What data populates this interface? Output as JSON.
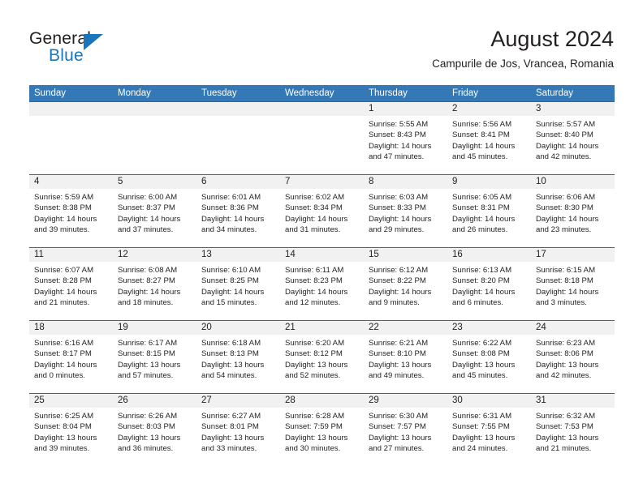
{
  "brand": {
    "name_part1": "General",
    "name_part2": "Blue",
    "triangle_color": "#1b75bb"
  },
  "header": {
    "title": "August 2024",
    "subtitle": "Campurile de Jos, Vrancea, Romania",
    "accent_color": "#3479b5",
    "numbers_strip_color": "#f1f1f1"
  },
  "day_names": [
    "Sunday",
    "Monday",
    "Tuesday",
    "Wednesday",
    "Thursday",
    "Friday",
    "Saturday"
  ],
  "labels": {
    "sunrise_prefix": "Sunrise:",
    "sunset_prefix": "Sunset:",
    "daylight_prefix": "Daylight:"
  },
  "weeks": [
    [
      {
        "day": "",
        "sunrise": "",
        "sunset": "",
        "daylight_line1": "",
        "daylight_line2": ""
      },
      {
        "day": "",
        "sunrise": "",
        "sunset": "",
        "daylight_line1": "",
        "daylight_line2": ""
      },
      {
        "day": "",
        "sunrise": "",
        "sunset": "",
        "daylight_line1": "",
        "daylight_line2": ""
      },
      {
        "day": "",
        "sunrise": "",
        "sunset": "",
        "daylight_line1": "",
        "daylight_line2": ""
      },
      {
        "day": "1",
        "sunrise": "Sunrise: 5:55 AM",
        "sunset": "Sunset: 8:43 PM",
        "daylight_line1": "Daylight: 14 hours",
        "daylight_line2": "and 47 minutes."
      },
      {
        "day": "2",
        "sunrise": "Sunrise: 5:56 AM",
        "sunset": "Sunset: 8:41 PM",
        "daylight_line1": "Daylight: 14 hours",
        "daylight_line2": "and 45 minutes."
      },
      {
        "day": "3",
        "sunrise": "Sunrise: 5:57 AM",
        "sunset": "Sunset: 8:40 PM",
        "daylight_line1": "Daylight: 14 hours",
        "daylight_line2": "and 42 minutes."
      }
    ],
    [
      {
        "day": "4",
        "sunrise": "Sunrise: 5:59 AM",
        "sunset": "Sunset: 8:38 PM",
        "daylight_line1": "Daylight: 14 hours",
        "daylight_line2": "and 39 minutes."
      },
      {
        "day": "5",
        "sunrise": "Sunrise: 6:00 AM",
        "sunset": "Sunset: 8:37 PM",
        "daylight_line1": "Daylight: 14 hours",
        "daylight_line2": "and 37 minutes."
      },
      {
        "day": "6",
        "sunrise": "Sunrise: 6:01 AM",
        "sunset": "Sunset: 8:36 PM",
        "daylight_line1": "Daylight: 14 hours",
        "daylight_line2": "and 34 minutes."
      },
      {
        "day": "7",
        "sunrise": "Sunrise: 6:02 AM",
        "sunset": "Sunset: 8:34 PM",
        "daylight_line1": "Daylight: 14 hours",
        "daylight_line2": "and 31 minutes."
      },
      {
        "day": "8",
        "sunrise": "Sunrise: 6:03 AM",
        "sunset": "Sunset: 8:33 PM",
        "daylight_line1": "Daylight: 14 hours",
        "daylight_line2": "and 29 minutes."
      },
      {
        "day": "9",
        "sunrise": "Sunrise: 6:05 AM",
        "sunset": "Sunset: 8:31 PM",
        "daylight_line1": "Daylight: 14 hours",
        "daylight_line2": "and 26 minutes."
      },
      {
        "day": "10",
        "sunrise": "Sunrise: 6:06 AM",
        "sunset": "Sunset: 8:30 PM",
        "daylight_line1": "Daylight: 14 hours",
        "daylight_line2": "and 23 minutes."
      }
    ],
    [
      {
        "day": "11",
        "sunrise": "Sunrise: 6:07 AM",
        "sunset": "Sunset: 8:28 PM",
        "daylight_line1": "Daylight: 14 hours",
        "daylight_line2": "and 21 minutes."
      },
      {
        "day": "12",
        "sunrise": "Sunrise: 6:08 AM",
        "sunset": "Sunset: 8:27 PM",
        "daylight_line1": "Daylight: 14 hours",
        "daylight_line2": "and 18 minutes."
      },
      {
        "day": "13",
        "sunrise": "Sunrise: 6:10 AM",
        "sunset": "Sunset: 8:25 PM",
        "daylight_line1": "Daylight: 14 hours",
        "daylight_line2": "and 15 minutes."
      },
      {
        "day": "14",
        "sunrise": "Sunrise: 6:11 AM",
        "sunset": "Sunset: 8:23 PM",
        "daylight_line1": "Daylight: 14 hours",
        "daylight_line2": "and 12 minutes."
      },
      {
        "day": "15",
        "sunrise": "Sunrise: 6:12 AM",
        "sunset": "Sunset: 8:22 PM",
        "daylight_line1": "Daylight: 14 hours",
        "daylight_line2": "and 9 minutes."
      },
      {
        "day": "16",
        "sunrise": "Sunrise: 6:13 AM",
        "sunset": "Sunset: 8:20 PM",
        "daylight_line1": "Daylight: 14 hours",
        "daylight_line2": "and 6 minutes."
      },
      {
        "day": "17",
        "sunrise": "Sunrise: 6:15 AM",
        "sunset": "Sunset: 8:18 PM",
        "daylight_line1": "Daylight: 14 hours",
        "daylight_line2": "and 3 minutes."
      }
    ],
    [
      {
        "day": "18",
        "sunrise": "Sunrise: 6:16 AM",
        "sunset": "Sunset: 8:17 PM",
        "daylight_line1": "Daylight: 14 hours",
        "daylight_line2": "and 0 minutes."
      },
      {
        "day": "19",
        "sunrise": "Sunrise: 6:17 AM",
        "sunset": "Sunset: 8:15 PM",
        "daylight_line1": "Daylight: 13 hours",
        "daylight_line2": "and 57 minutes."
      },
      {
        "day": "20",
        "sunrise": "Sunrise: 6:18 AM",
        "sunset": "Sunset: 8:13 PM",
        "daylight_line1": "Daylight: 13 hours",
        "daylight_line2": "and 54 minutes."
      },
      {
        "day": "21",
        "sunrise": "Sunrise: 6:20 AM",
        "sunset": "Sunset: 8:12 PM",
        "daylight_line1": "Daylight: 13 hours",
        "daylight_line2": "and 52 minutes."
      },
      {
        "day": "22",
        "sunrise": "Sunrise: 6:21 AM",
        "sunset": "Sunset: 8:10 PM",
        "daylight_line1": "Daylight: 13 hours",
        "daylight_line2": "and 49 minutes."
      },
      {
        "day": "23",
        "sunrise": "Sunrise: 6:22 AM",
        "sunset": "Sunset: 8:08 PM",
        "daylight_line1": "Daylight: 13 hours",
        "daylight_line2": "and 45 minutes."
      },
      {
        "day": "24",
        "sunrise": "Sunrise: 6:23 AM",
        "sunset": "Sunset: 8:06 PM",
        "daylight_line1": "Daylight: 13 hours",
        "daylight_line2": "and 42 minutes."
      }
    ],
    [
      {
        "day": "25",
        "sunrise": "Sunrise: 6:25 AM",
        "sunset": "Sunset: 8:04 PM",
        "daylight_line1": "Daylight: 13 hours",
        "daylight_line2": "and 39 minutes."
      },
      {
        "day": "26",
        "sunrise": "Sunrise: 6:26 AM",
        "sunset": "Sunset: 8:03 PM",
        "daylight_line1": "Daylight: 13 hours",
        "daylight_line2": "and 36 minutes."
      },
      {
        "day": "27",
        "sunrise": "Sunrise: 6:27 AM",
        "sunset": "Sunset: 8:01 PM",
        "daylight_line1": "Daylight: 13 hours",
        "daylight_line2": "and 33 minutes."
      },
      {
        "day": "28",
        "sunrise": "Sunrise: 6:28 AM",
        "sunset": "Sunset: 7:59 PM",
        "daylight_line1": "Daylight: 13 hours",
        "daylight_line2": "and 30 minutes."
      },
      {
        "day": "29",
        "sunrise": "Sunrise: 6:30 AM",
        "sunset": "Sunset: 7:57 PM",
        "daylight_line1": "Daylight: 13 hours",
        "daylight_line2": "and 27 minutes."
      },
      {
        "day": "30",
        "sunrise": "Sunrise: 6:31 AM",
        "sunset": "Sunset: 7:55 PM",
        "daylight_line1": "Daylight: 13 hours",
        "daylight_line2": "and 24 minutes."
      },
      {
        "day": "31",
        "sunrise": "Sunrise: 6:32 AM",
        "sunset": "Sunset: 7:53 PM",
        "daylight_line1": "Daylight: 13 hours",
        "daylight_line2": "and 21 minutes."
      }
    ]
  ]
}
